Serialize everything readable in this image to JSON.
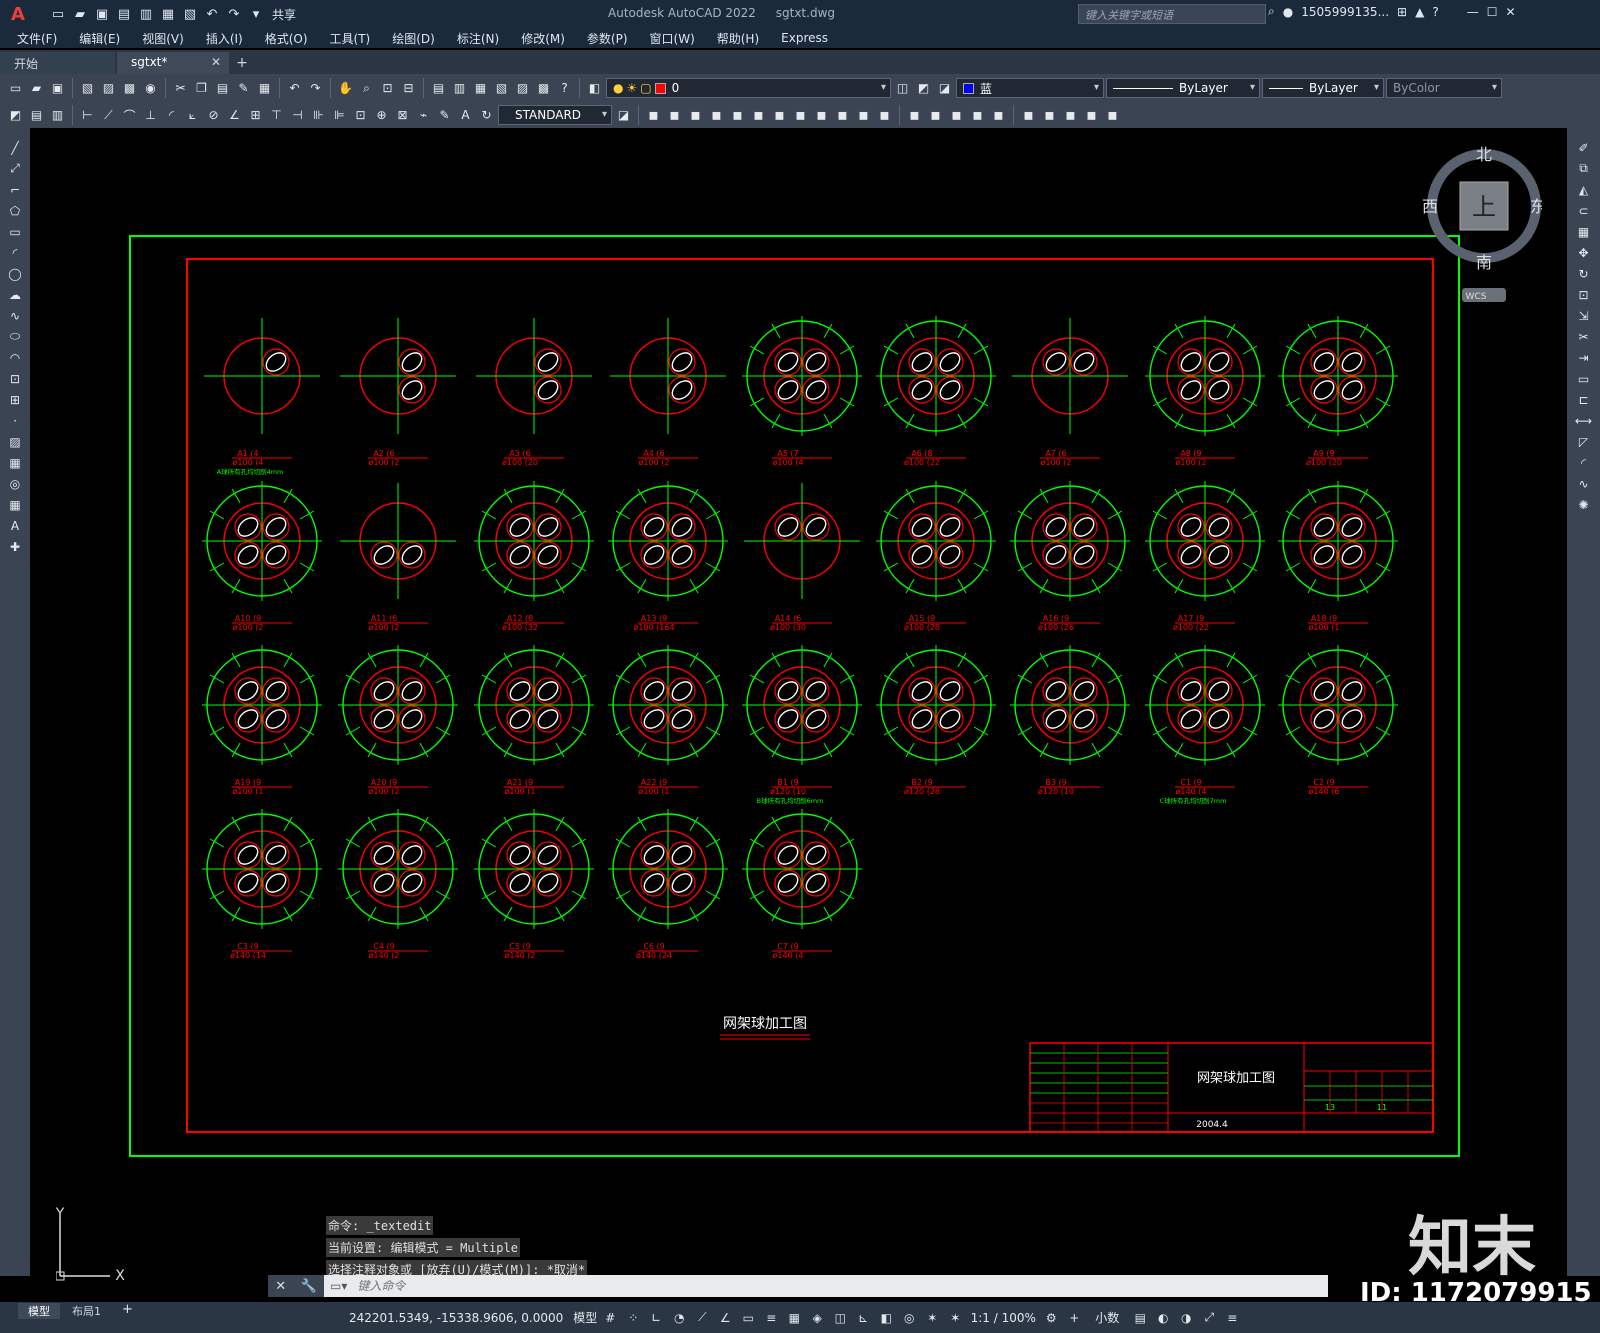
{
  "titlebar": {
    "app_title": "Autodesk AutoCAD 2022",
    "file_name": "sgtxt.dwg",
    "share_label": "共享",
    "search_placeholder": "键入关键字或短语",
    "user": "1505999135...",
    "logo": "A"
  },
  "menu": [
    "文件(F)",
    "编辑(E)",
    "视图(V)",
    "插入(I)",
    "格式(O)",
    "工具(T)",
    "绘图(D)",
    "标注(N)",
    "修改(M)",
    "参数(P)",
    "窗口(W)",
    "帮助(H)",
    "Express"
  ],
  "tabs": [
    {
      "label": "开始"
    },
    {
      "label": "sgtxt*"
    }
  ],
  "layer_combo": "0",
  "color_combo": "蓝",
  "linetype_combo": "ByLayer",
  "lineweight_combo": "ByLayer",
  "plotstyle_combo": "ByColor",
  "textstyle_combo": "STANDARD",
  "viewcube": {
    "north": "北",
    "south": "南",
    "east": "东",
    "west": "西",
    "top": "上",
    "wcs": "WCS"
  },
  "drawing": {
    "title": "网架球加工图",
    "titleblock_title": "网架球加工图",
    "date": "2004.4",
    "sheet_total": "13",
    "sheet_no": "11",
    "nodes": [
      [
        "A1 (4",
        "ø100 (4"
      ],
      [
        "A2 (6",
        "ø100 (2"
      ],
      [
        "A3 (6",
        "ø100 (20"
      ],
      [
        "A4 (6",
        "ø100 (2"
      ],
      [
        "A5 (7",
        "ø100 (4"
      ],
      [
        "A6 (8",
        "ø100 (22"
      ],
      [
        "A7 (6",
        "ø100 (2"
      ],
      [
        "A8 (9",
        "ø100 (2"
      ],
      [
        "A9 (9",
        "ø100 (20"
      ],
      [
        "A10 (9",
        "ø100 (2"
      ],
      [
        "A11 (6",
        "ø100 (2"
      ],
      [
        "A12 (8",
        "ø100 (32"
      ],
      [
        "A13 (9",
        "ø100 (164"
      ],
      [
        "A14 (6",
        "ø100 (30"
      ],
      [
        "A15 (9",
        "ø100 (28"
      ],
      [
        "A16 (9",
        "ø100 (26"
      ],
      [
        "A17 (9",
        "ø100 (22"
      ],
      [
        "A18 (9",
        "ø100 (1"
      ],
      [
        "A19 (9",
        "ø100 (1"
      ],
      [
        "A20 (9",
        "ø100 (2"
      ],
      [
        "A21 (9",
        "ø100 (1"
      ],
      [
        "A22 (9",
        "ø100 (1"
      ],
      [
        "B1 (9",
        "ø120 (10"
      ],
      [
        "B2 (9",
        "ø120 (28"
      ],
      [
        "B3 (9",
        "ø120 (10"
      ],
      [
        "C1 (9",
        "ø140 (4"
      ],
      [
        "C2 (9",
        "ø140 (6"
      ],
      [
        "C3 (9",
        "ø140 (14"
      ],
      [
        "C4 (9",
        "ø140 (2"
      ],
      [
        "C5 (9",
        "ø140 (2"
      ],
      [
        "C6 (9",
        "ø140 (24"
      ],
      [
        "C7 (9",
        "ø140 (4"
      ]
    ],
    "notes": {
      "A": "A球所有孔均切削4mm",
      "B": "B球所有孔均切削6mm",
      "C": "C球所有孔均切削7mm"
    }
  },
  "command_history": [
    "命令: _textedit",
    "当前设置: 编辑模式 = Multiple",
    "选择注释对象或 [放弃(U)/模式(M)]: *取消*"
  ],
  "command_placeholder": "键入命令",
  "layout_tabs": [
    "模型",
    "布局1"
  ],
  "status": {
    "coords": "242201.5349, -15338.9606, 0.0000",
    "model": "模型",
    "scale": "1:1 / 100%",
    "units": "小数"
  },
  "watermark": {
    "brand": "知末",
    "id": "ID: 1172079915"
  },
  "colors": {
    "frame_green": "#00ff00",
    "frame_red": "#ff0000",
    "ui_dark": "#1b2a3b",
    "ui_mid": "#3b4453"
  }
}
